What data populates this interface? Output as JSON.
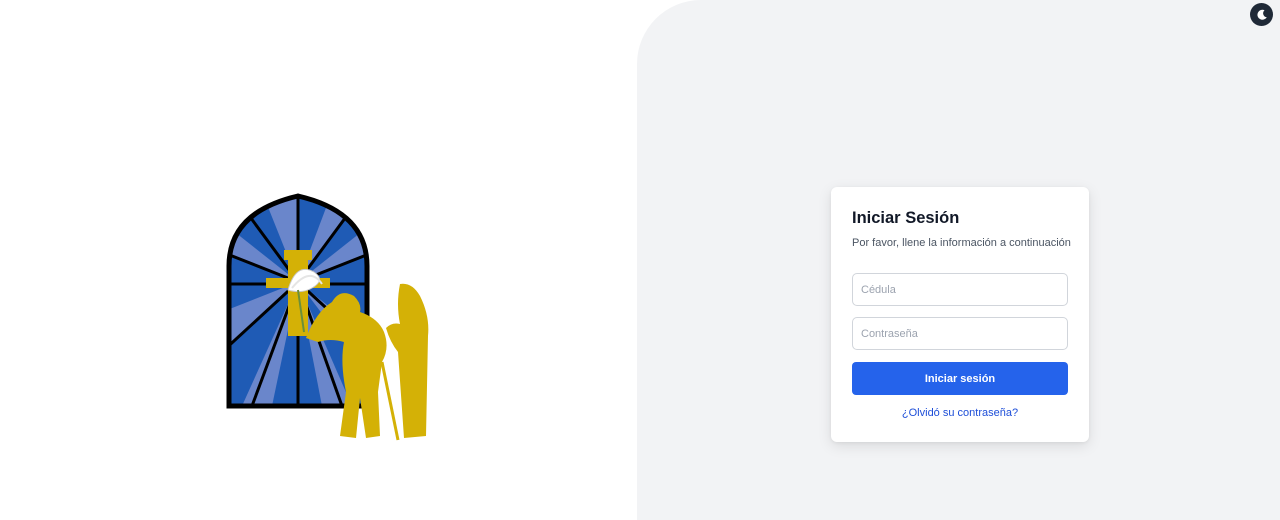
{
  "login": {
    "title": "Iniciar Sesión",
    "subtitle": "Por favor, llene la información a continuación",
    "cedula_placeholder": "Cédula",
    "cedula_value": "",
    "password_placeholder": "Contraseña",
    "password_value": "",
    "submit_label": "Iniciar sesión",
    "forgot_label": "¿Olvidó su contraseña?"
  },
  "theme_toggle": {
    "icon": "moon-icon"
  },
  "logo": {
    "icon": "stained-glass-window-logo"
  },
  "colors": {
    "primary": "#2563eb",
    "link": "#1d4ed8",
    "right_panel_bg": "#f2f3f5",
    "title": "#111827",
    "logo_gold": "#d4b106",
    "window_blue": "#1f5bb5",
    "window_light_blue": "#6a86cb"
  }
}
